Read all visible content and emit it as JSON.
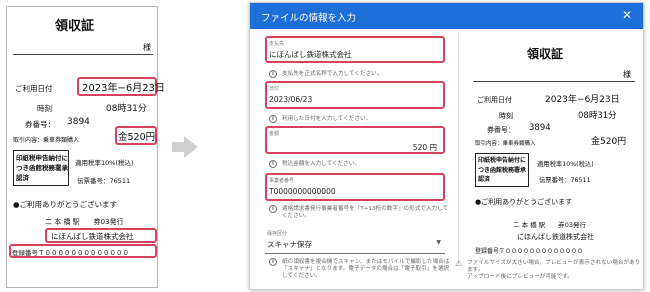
{
  "receipt": {
    "title": "領収証",
    "addressee_suffix": "様",
    "usage_date_label": "ご利用日付",
    "usage_date_value": "2023年−6月23日",
    "time_label": "時刻",
    "time_value": "08時31分",
    "ticket_number_label": "券番号：",
    "ticket_number_value": "3894",
    "transaction_label": "取引内容：乗車券類購入",
    "amount_value": "金520円",
    "tax_stamp_note": "印紙税申告納付につき函館税務署承認済",
    "tax_rate": "適用税率10%(税込)",
    "slip_number": "伝票番号：76511",
    "thanks": "●ご利用ありがとうございます",
    "station": "二 本 橋 駅　　券03発行",
    "company": "にほんばし鉄道株式会社",
    "registration": "登録番号Ｔ０００００００００００００"
  },
  "dialog": {
    "title": "ファイルの情報を入力",
    "close_icon": "close-icon",
    "fields": {
      "payee": {
        "label": "支払先",
        "value": "にほんばし鉄道株式会社",
        "hint": "支払先を正式名称で入力してください。"
      },
      "date": {
        "label": "日付",
        "value": "2023/06/23",
        "hint": "利用した日付を入力してください。"
      },
      "amount": {
        "label": "金額",
        "value": "520 円",
        "hint": "税込金額を入力してください。"
      },
      "registration": {
        "label": "事業者番号",
        "value": "T0000000000000",
        "hint": "適格請求書発行事業者番号を『T+13桁の数字』の形式で入力してください。"
      },
      "storage": {
        "label": "保存区分",
        "value": "スキャナ保存",
        "hint": "紙の領収書を複合機でスキャン、またはモバイルで撮影した場合は「スキャナ」となります。電子データの場合は「電子取引」を選択してください。"
      }
    },
    "warning": "ファイルサイズが大きい場合、プレビューが表示されない場合があります。\nアップロード後にプレビューが可能です。"
  },
  "colors": {
    "header": "#1e6fd8",
    "highlight": "#d6435c"
  },
  "icons": [
    "info-icon",
    "warning-icon",
    "chevron-down-icon",
    "arrow-right-icon"
  ]
}
